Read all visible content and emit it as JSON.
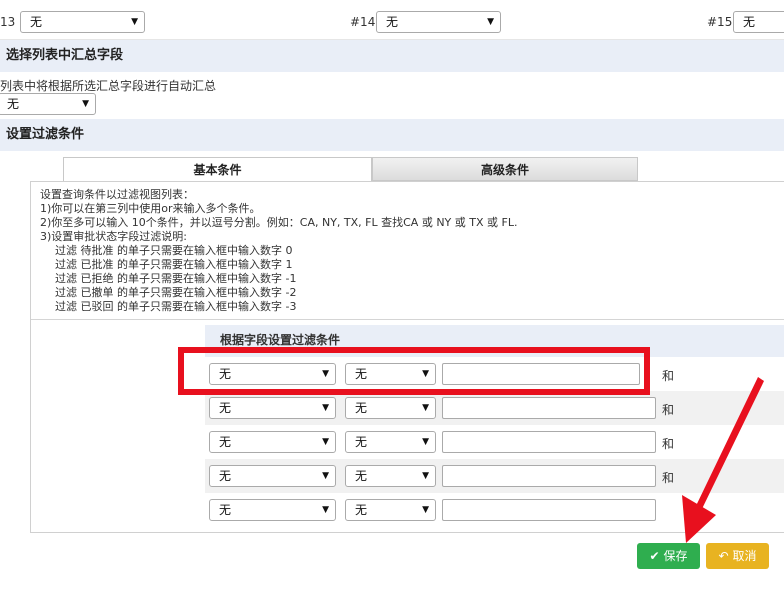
{
  "top_row": {
    "col13_label": "13",
    "col13_value": "无",
    "col14_label": "#14",
    "col14_value": "无",
    "col15_label": "#15",
    "col15_value": "无"
  },
  "summary_section": {
    "title": "选择列表中汇总字段",
    "hint": "列表中将根据所选汇总字段进行自动汇总",
    "select_value": "无"
  },
  "filter_section": {
    "title": "设置过滤条件",
    "tabs": [
      {
        "label": "基本条件",
        "active": true
      },
      {
        "label": "高级条件",
        "active": false
      }
    ],
    "description": [
      "设置查询条件以过滤视图列表：",
      "1)你可以在第三列中使用or来输入多个条件。",
      "2)你至多可以输入 10个条件，并以逗号分割。例如：CA, NY, TX, FL 查找CA 或 NY 或 TX 或 FL.",
      "3)设置审批状态字段过滤说明:"
    ],
    "status_lines": [
      "过滤 待批准 的单子只需要在输入框中输入数字 0",
      "过滤 已批准 的单子只需要在输入框中输入数字 1",
      "过滤 已拒绝 的单子只需要在输入框中输入数字 -1",
      "过滤 已撤单 的单子只需要在输入框中输入数字 -2",
      "过滤 已驳回 的单子只需要在输入框中输入数字 -3"
    ],
    "filter_header": "根据字段设置过滤条件",
    "rows": [
      {
        "field": "无",
        "op": "无",
        "value": "",
        "join": "和"
      },
      {
        "field": "无",
        "op": "无",
        "value": "",
        "join": "和"
      },
      {
        "field": "无",
        "op": "无",
        "value": "",
        "join": "和"
      },
      {
        "field": "无",
        "op": "无",
        "value": "",
        "join": "和"
      },
      {
        "field": "无",
        "op": "无",
        "value": "",
        "join": ""
      }
    ]
  },
  "buttons": {
    "save_label": "保存",
    "cancel_label": "取消"
  },
  "colors": {
    "accent_red": "#e8101e",
    "save_green": "#2fae4f",
    "cancel_yellow": "#e8b321",
    "section_bg": "#e9eef7"
  }
}
